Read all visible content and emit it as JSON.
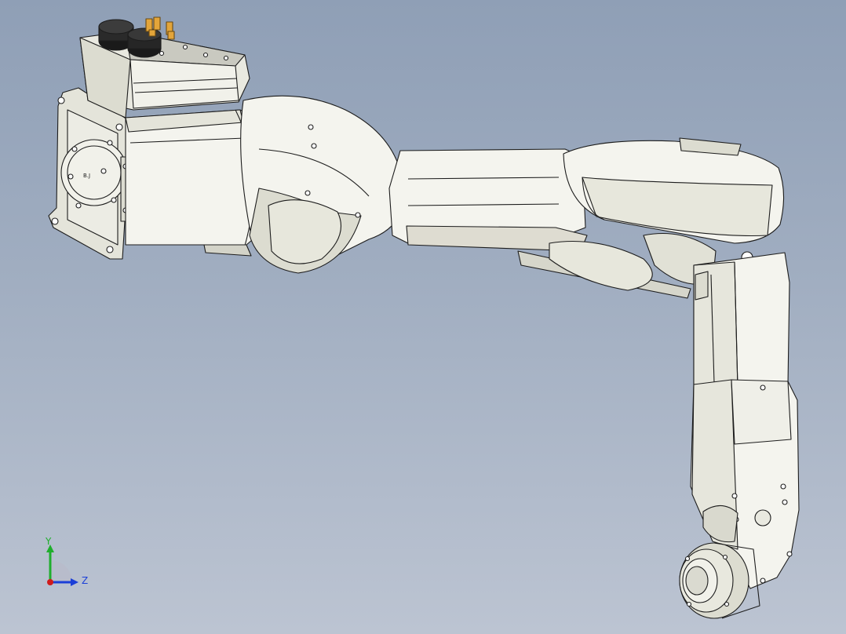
{
  "viewport": {
    "background_top": "#8f9fb6",
    "background_bottom": "#bcc4d2",
    "model": "six-axis-robot-arm",
    "render_style": "shaded-with-edges",
    "body_color": "#f3f3ee",
    "shadow_color": "#d9d9cf",
    "edge_color": "#1d1d1d",
    "connector_color": "#e3a53a",
    "base_label": "B.J"
  },
  "triad": {
    "y_label": "Y",
    "z_label": "Z",
    "y_color": "#1fae2c",
    "z_color": "#1b3fd8",
    "x_color": "#d01b1b"
  }
}
